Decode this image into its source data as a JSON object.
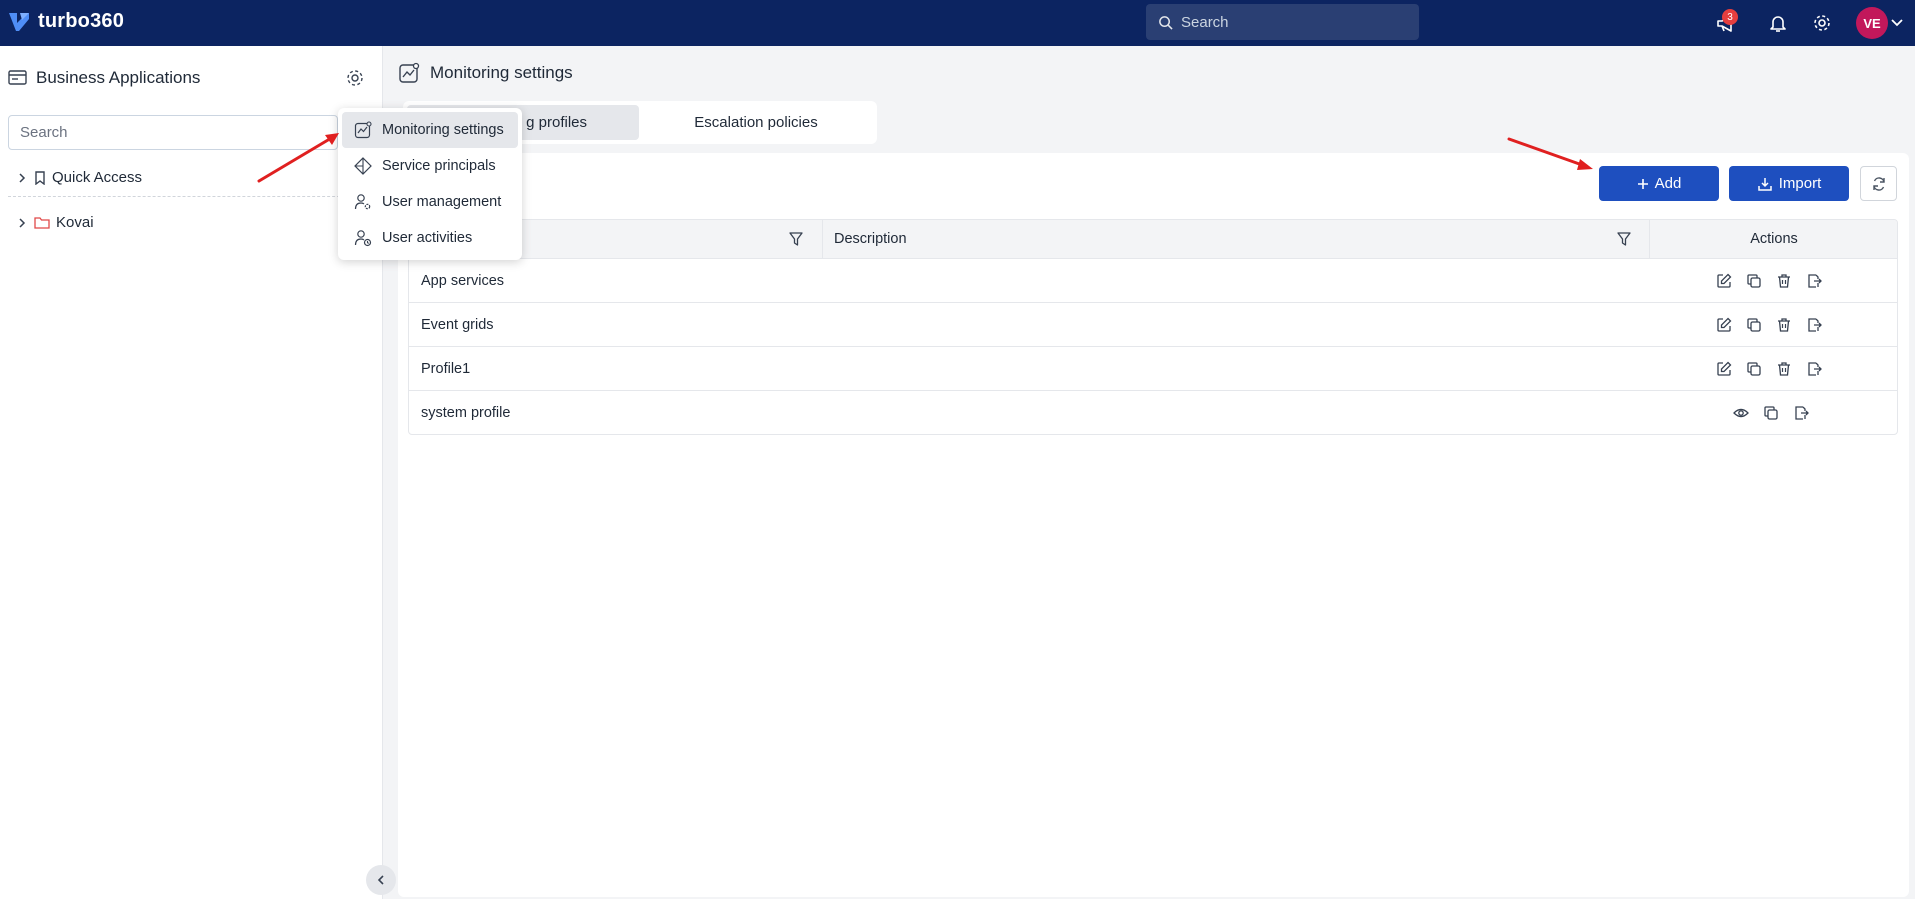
{
  "topbar": {
    "brand": "turbo360",
    "search_placeholder": "Search",
    "announcements_badge": "3",
    "avatar_initials": "VE",
    "icons": [
      "brand-logo-icon",
      "search-icon",
      "megaphone-icon",
      "bell-icon",
      "gear-icon",
      "chevron-down-icon"
    ]
  },
  "sidebar": {
    "title": "Business Applications",
    "search_placeholder": "Search",
    "tree": [
      {
        "label": "Quick Access",
        "icon": "bookmark-icon"
      },
      {
        "label": "Kovai",
        "icon": "folder-icon"
      }
    ]
  },
  "settings_menu": {
    "items": [
      {
        "label": "Monitoring settings",
        "icon": "monitoring-icon",
        "active": true
      },
      {
        "label": "Service principals",
        "icon": "diamond-icon",
        "active": false
      },
      {
        "label": "User management",
        "icon": "user-gear-icon",
        "active": false
      },
      {
        "label": "User activities",
        "icon": "user-clock-icon",
        "active": false
      }
    ]
  },
  "main": {
    "title": "Monitoring settings",
    "tabs": [
      {
        "label": "g profiles",
        "active": true
      },
      {
        "label": "Escalation policies",
        "active": false
      }
    ],
    "toolbar": {
      "add_label": "Add",
      "import_label": "Import"
    },
    "table": {
      "columns": [
        "",
        "Description",
        "Actions"
      ],
      "rows": [
        {
          "name": "App services",
          "description": "",
          "actions": [
            "edit-icon",
            "copy-icon",
            "delete-icon",
            "export-icon"
          ]
        },
        {
          "name": "Event grids",
          "description": "",
          "actions": [
            "edit-icon",
            "copy-icon",
            "delete-icon",
            "export-icon"
          ]
        },
        {
          "name": "Profile1",
          "description": "",
          "actions": [
            "edit-icon",
            "copy-icon",
            "delete-icon",
            "export-icon"
          ]
        },
        {
          "name": "system profile",
          "description": "",
          "actions": [
            "view-icon",
            "copy-icon",
            "export-icon"
          ]
        }
      ]
    }
  },
  "colors": {
    "topbar": "#0c2461",
    "primary_button": "#1e4fbf",
    "avatar": "#c2185b",
    "badge": "#e53e3e",
    "annotation_arrow": "#e02020"
  }
}
